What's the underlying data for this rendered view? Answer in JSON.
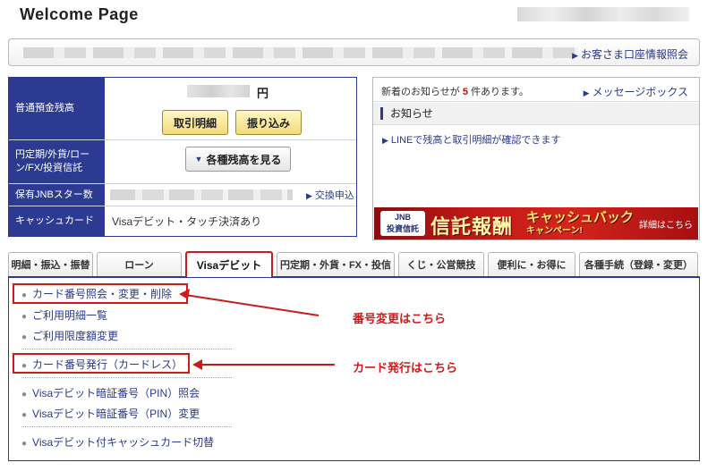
{
  "header": {
    "title": "Welcome Page"
  },
  "account_bar": {
    "link_label": "お客さま口座情報照会"
  },
  "summary": {
    "balance_label": "普通預金残高",
    "currency": "円",
    "btn_statement": "取引明細",
    "btn_transfer": "振り込み",
    "other_label": "円定期/外貨/ローン/FX/投資信託",
    "btn_view_balances": "各種残高を見る",
    "star_label": "保有JNBスター数",
    "exchange_link": "交換申込",
    "cashcard_label": "キャッシュカード",
    "cashcard_value": "Visaデビット・タッチ決済あり"
  },
  "news": {
    "count_prefix": "新着のお知らせが",
    "count": "5",
    "count_suffix": "件あります。",
    "messagebox_link": "メッセージボックス",
    "notice_title": "お知らせ",
    "notice_item": "LINEで残高と取引明細が確認できます",
    "banner": {
      "logo_line1": "JNB",
      "logo_line2": "投資信託",
      "main_text": "信託報酬",
      "sub_line1": "キャッシュバック",
      "sub_line2": "キャンペーン!",
      "detail_link": "詳細はこちら"
    }
  },
  "tabs": [
    {
      "label": "明細・振込・振替"
    },
    {
      "label": "ローン"
    },
    {
      "label": "Visaデビット",
      "active": true
    },
    {
      "label": "円定期・外貨・FX・投信"
    },
    {
      "label": "くじ・公営競技"
    },
    {
      "label": "便利に・お得に"
    },
    {
      "label": "各種手続（登録・変更）"
    }
  ],
  "menu": [
    "カード番号照会・変更・削除",
    "ご利用明細一覧",
    "ご利用限度額変更",
    "カード番号発行（カードレス）",
    "Visaデビット暗証番号（PIN）照会",
    "Visaデビット暗証番号（PIN）変更",
    "Visaデビット付キャッシュカード切替"
  ],
  "annotations": {
    "number_change": "番号変更はこちら",
    "card_issue": "カード発行はこちら"
  },
  "colors": {
    "navy": "#2c3b91",
    "highlight_red": "#cc1b1b",
    "button_yellow": "#f2dc7a"
  }
}
